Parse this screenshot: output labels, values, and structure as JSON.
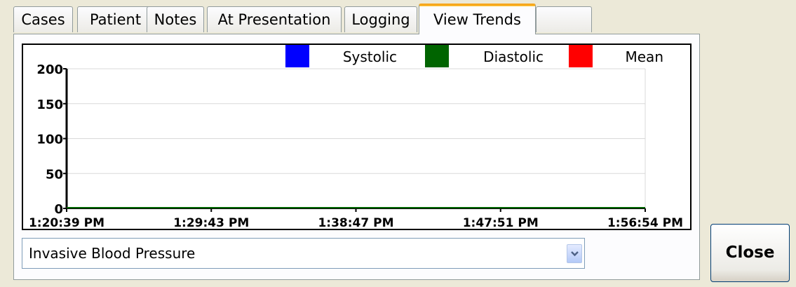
{
  "tabs": [
    {
      "label": "Cases",
      "active": false
    },
    {
      "label": "Patient",
      "active": false
    },
    {
      "label": "Notes",
      "active": false
    },
    {
      "label": "At Presentation",
      "active": false
    },
    {
      "label": "Logging",
      "active": false
    },
    {
      "label": "View Trends",
      "active": true
    },
    {
      "label": "",
      "active": false
    }
  ],
  "chart_data": {
    "type": "line",
    "title": "",
    "xlabel": "",
    "ylabel": "",
    "ylim": [
      0,
      200
    ],
    "yticks": [
      "200",
      "150",
      "100",
      "50",
      "0"
    ],
    "xticks": [
      "1:20:39 PM",
      "1:29:43 PM",
      "1:38:47 PM",
      "1:47:51 PM",
      "1:56:54 PM"
    ],
    "grid": true,
    "legend_position": "top",
    "series": [
      {
        "name": "Systolic",
        "color": "#0000ff",
        "values": []
      },
      {
        "name": "Diastolic",
        "color": "#006400",
        "values": []
      },
      {
        "name": "Mean",
        "color": "#ff0000",
        "values": []
      }
    ]
  },
  "trend_select": {
    "value": "Invasive Blood Pressure",
    "icon": "chevron-down-icon"
  },
  "close_label": "Close"
}
